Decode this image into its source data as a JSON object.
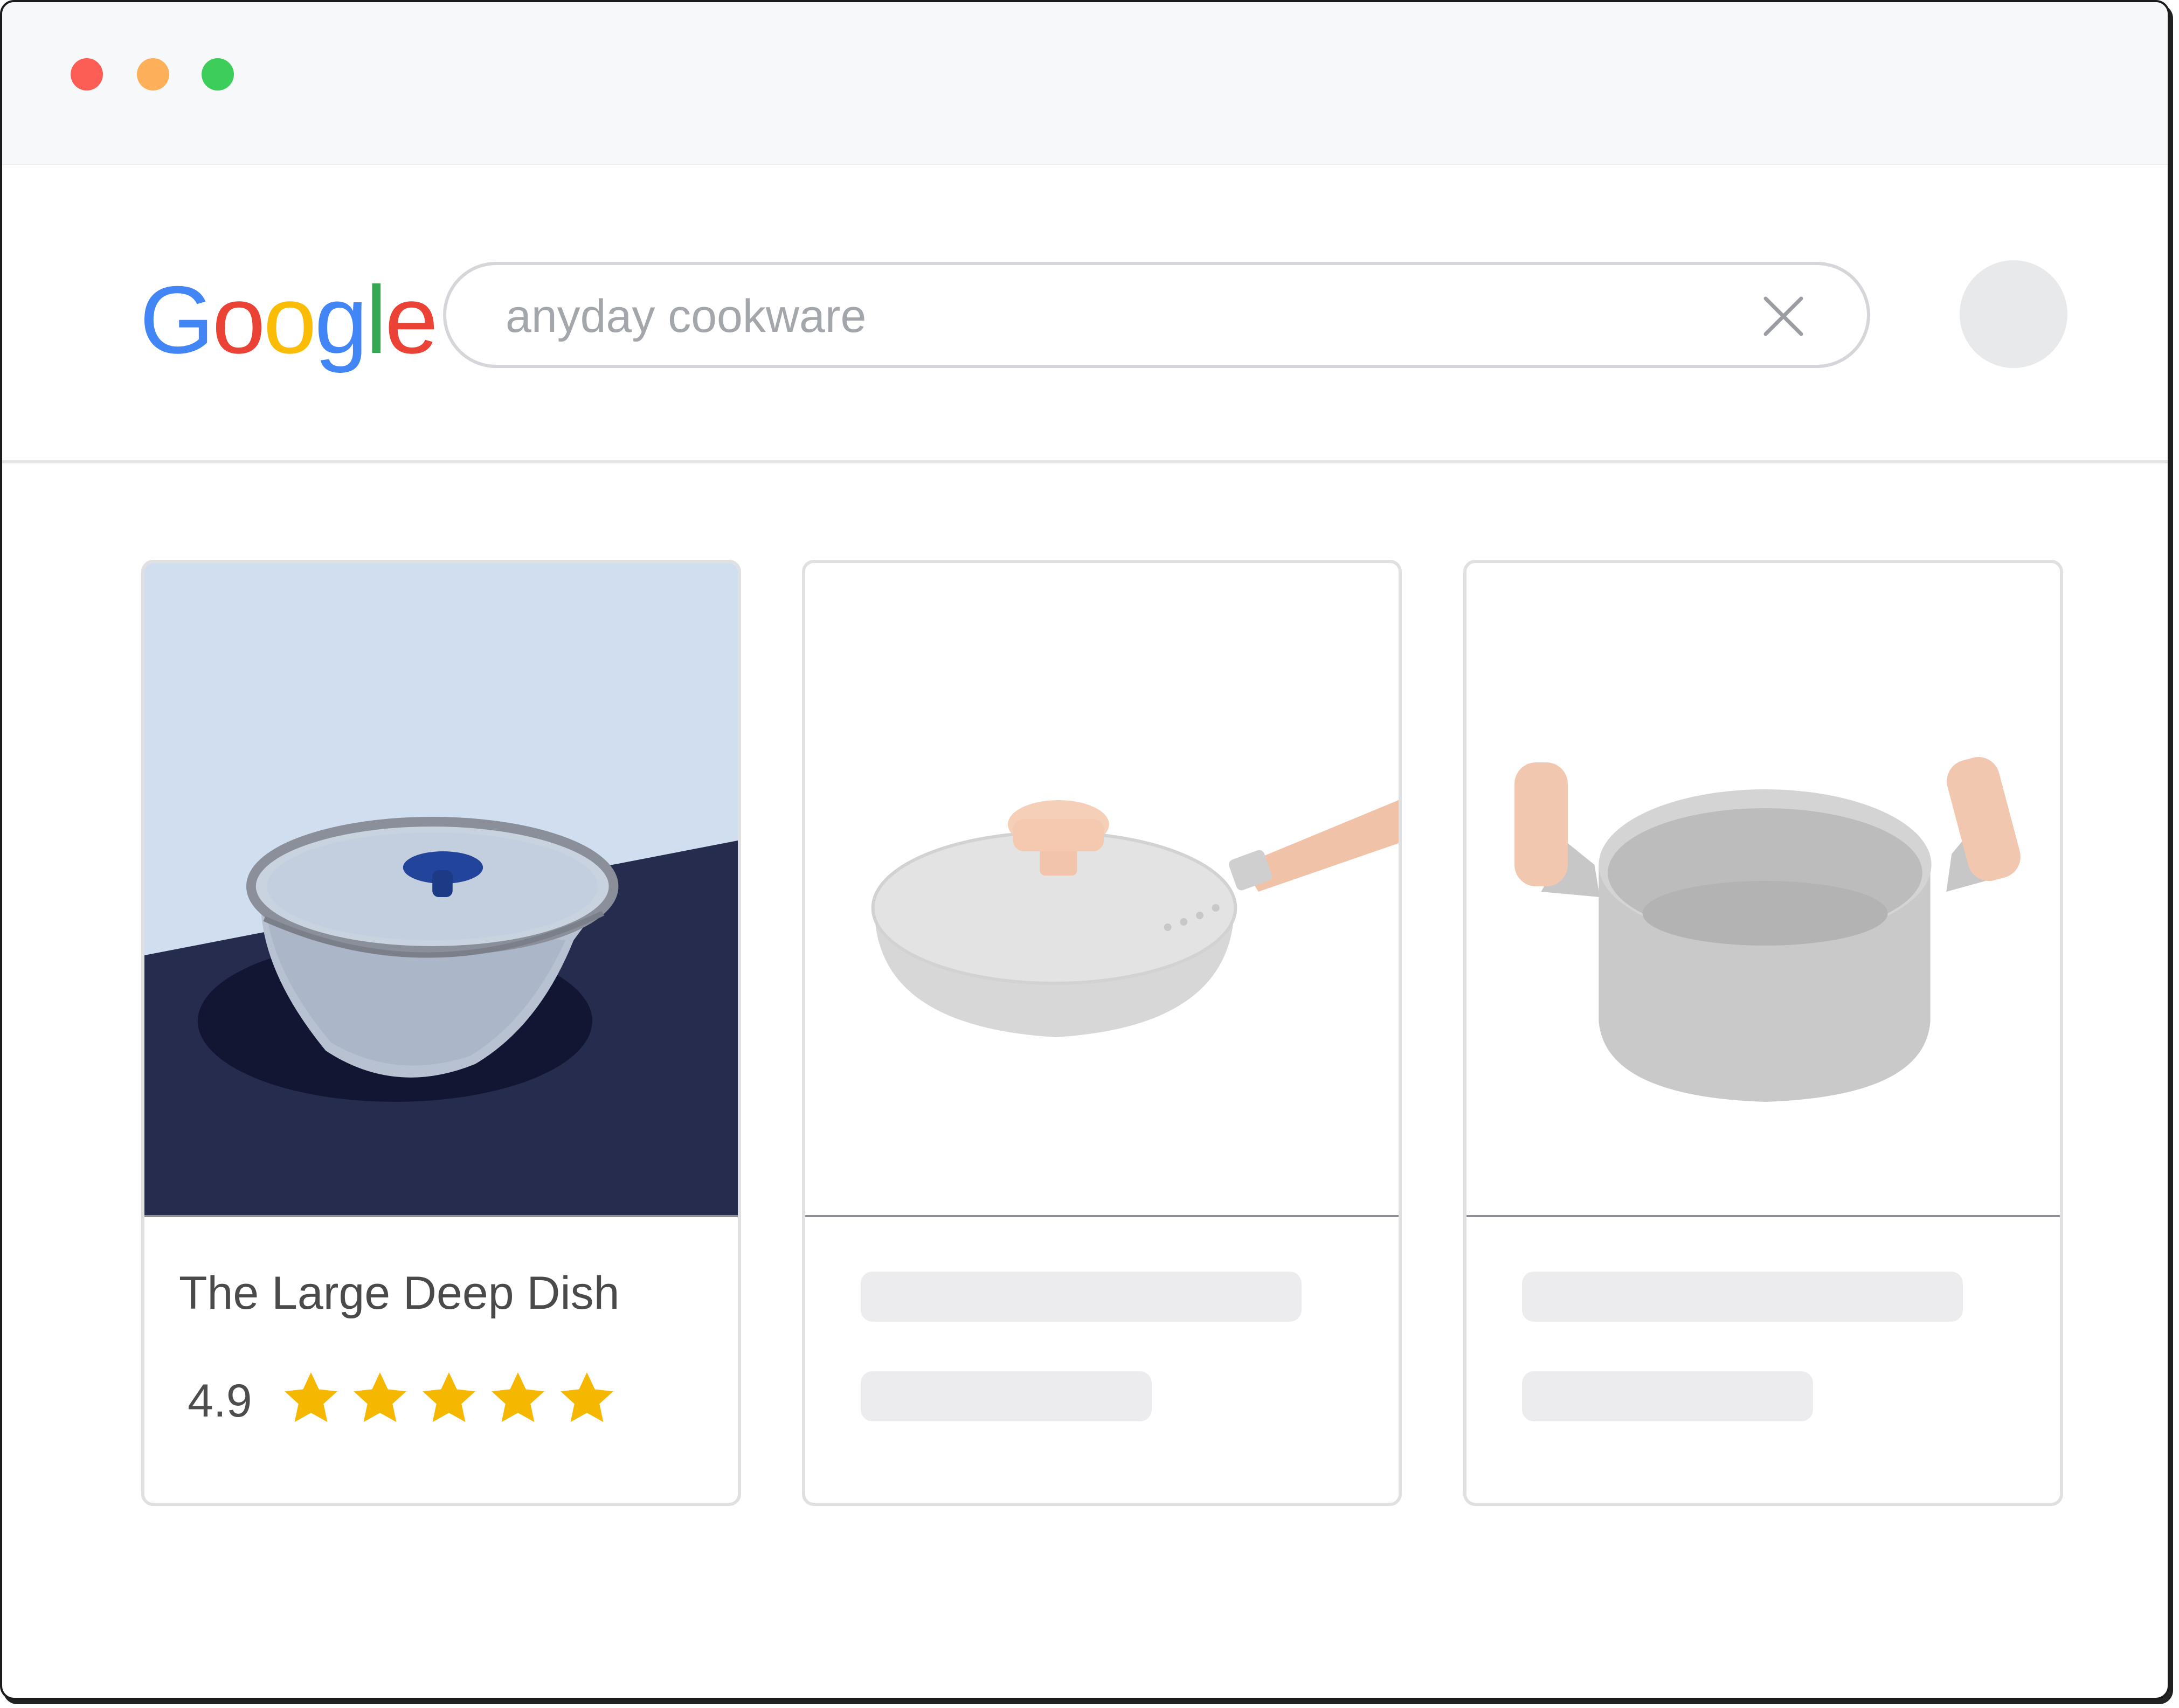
{
  "window": {
    "traffic_lights": [
      {
        "name": "close",
        "color": "#fc5e56"
      },
      {
        "name": "minimize",
        "color": "#fdaf5a"
      },
      {
        "name": "maximize",
        "color": "#3ccd5a"
      }
    ]
  },
  "logo": {
    "letters": [
      {
        "char": "G",
        "color": "#4285F4"
      },
      {
        "char": "o",
        "color": "#EA4335"
      },
      {
        "char": "o",
        "color": "#FBBC05"
      },
      {
        "char": "g",
        "color": "#4285F4"
      },
      {
        "char": "l",
        "color": "#34A853"
      },
      {
        "char": "e",
        "color": "#EA4335"
      }
    ]
  },
  "search": {
    "query": "anyday cookware",
    "clear_icon": "close-icon"
  },
  "results": [
    {
      "title": "The Large Deep Dish",
      "rating": "4.9",
      "stars": 5,
      "star_color": "#f6b700",
      "image": "deep-dish-bowl-with-glass-lid"
    },
    {
      "title": "",
      "image": "saute-pan-with-lid-faded",
      "placeholder": true
    },
    {
      "title": "",
      "image": "stock-pot-with-handles-faded",
      "placeholder": true
    }
  ]
}
